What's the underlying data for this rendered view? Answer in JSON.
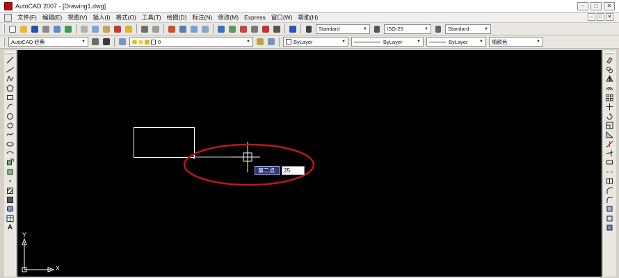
{
  "window": {
    "title": "AutoCAD 2007 - [Drawing1.dwg]"
  },
  "menus": [
    "文件(F)",
    "编辑(E)",
    "视图(V)",
    "插入(I)",
    "格式(O)",
    "工具(T)",
    "绘图(D)",
    "标注(N)",
    "修改(M)",
    "Express",
    "窗口(W)",
    "帮助(H)"
  ],
  "toolbar": {
    "text_style": "Standard",
    "dim_style": "ISO-25",
    "table_style": "Standard",
    "workspace": "AutoCAD 经典",
    "layer": "0",
    "color": "ByLayer",
    "linetype": "ByLayer",
    "lineweight": "ByLayer",
    "plot_style": "随颜色"
  },
  "canvas": {
    "prompt_label": "第二点:",
    "prompt_value": "25",
    "ucs_x": "X",
    "ucs_y": "Y"
  },
  "colors": {
    "canvas_bg": "#000000",
    "highlight_ellipse": "#c01818",
    "prompt_bg": "#2b3678"
  }
}
